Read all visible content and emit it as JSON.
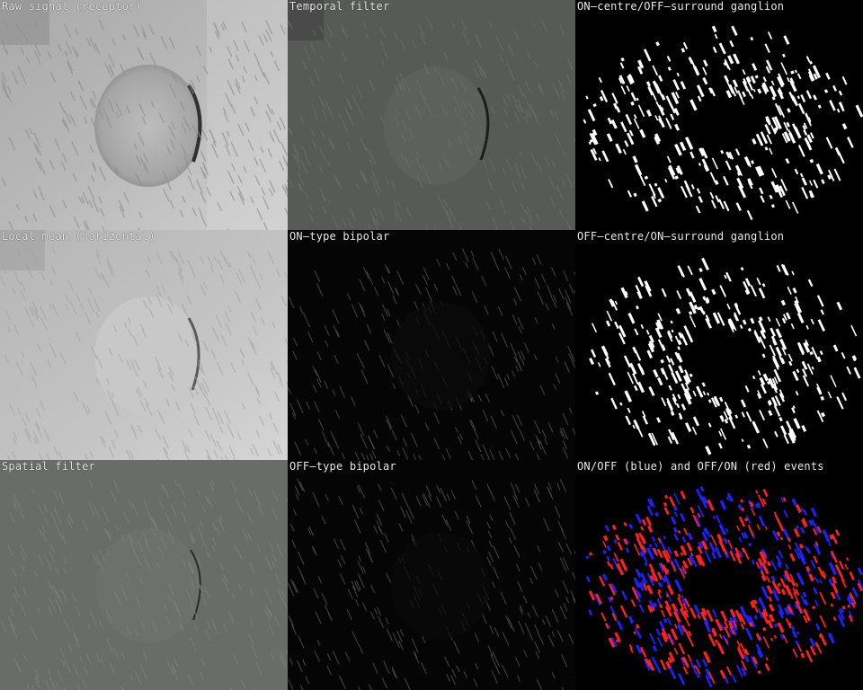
{
  "panels": [
    {
      "label": "Raw signal (receptor)"
    },
    {
      "label": "Temporal filter"
    },
    {
      "label": "ON—centre/OFF—surround ganglion"
    },
    {
      "label": "Local mean (horizontal)"
    },
    {
      "label": "ON—type bipolar"
    },
    {
      "label": "OFF—centre/ON—surround ganglion"
    },
    {
      "label": "Spatial filter"
    },
    {
      "label": "OFF—type bipolar"
    },
    {
      "label": "ON/OFF (blue) and OFF/ON (red) events"
    }
  ],
  "colors": {
    "on_off_event": "#2020ff",
    "off_on_event": "#ff2020",
    "background": "#000000"
  }
}
